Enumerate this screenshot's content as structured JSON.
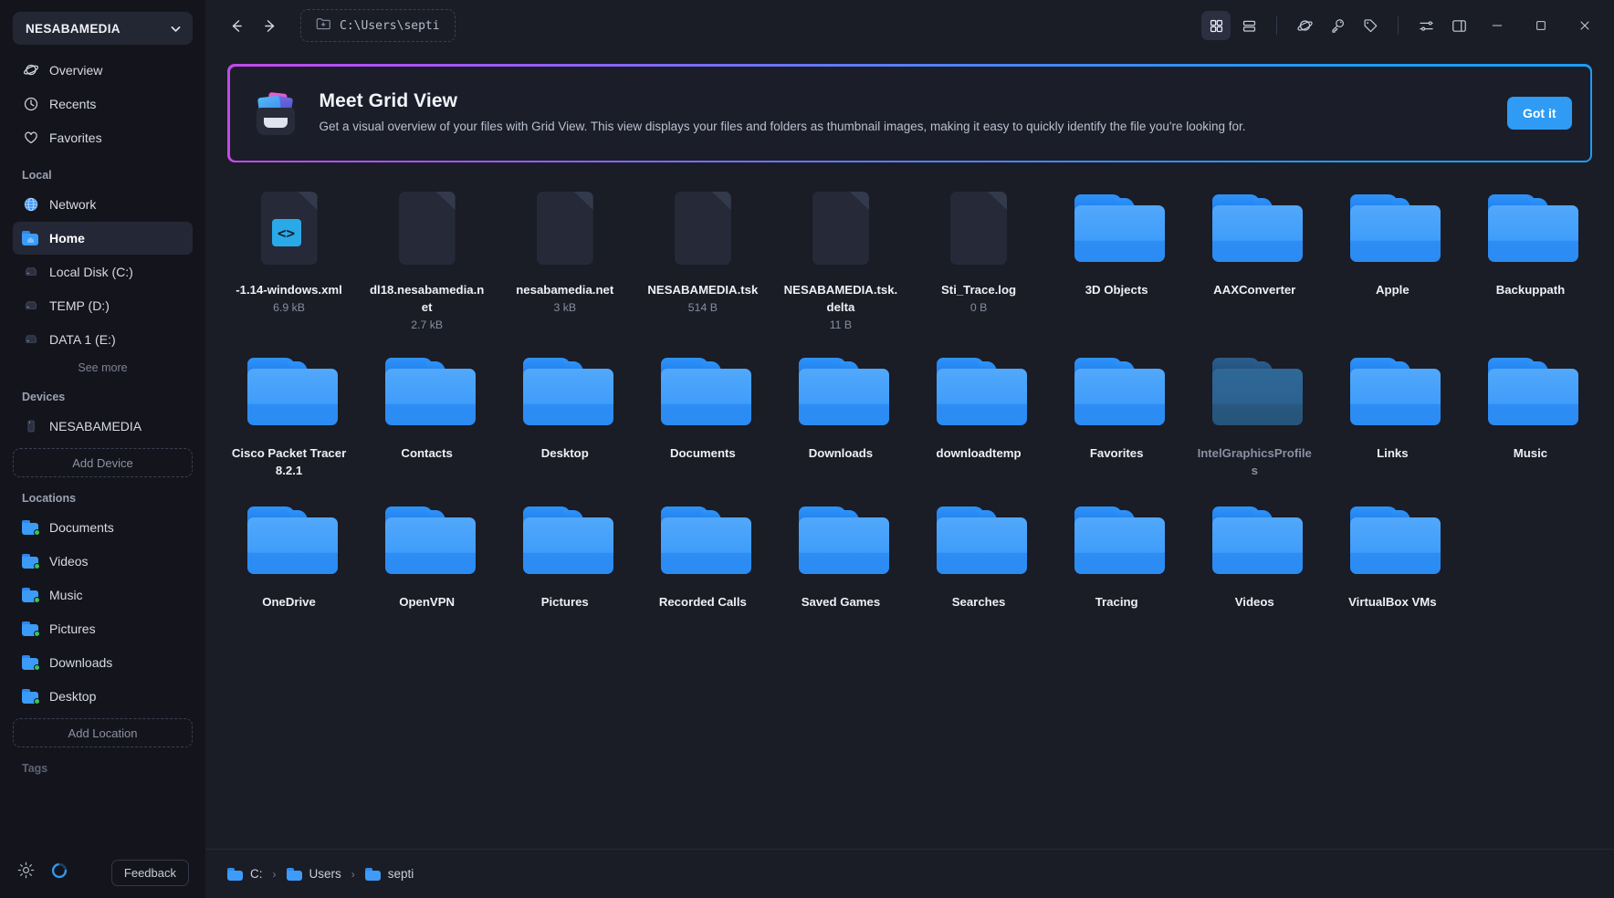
{
  "sidebar": {
    "drive_selector": {
      "label": "NESABAMEDIA",
      "icon": "chevron-down-icon"
    },
    "top_items": [
      {
        "label": "Overview",
        "icon": "planet-icon"
      },
      {
        "label": "Recents",
        "icon": "clock-icon"
      },
      {
        "label": "Favorites",
        "icon": "heart-icon"
      }
    ],
    "local": {
      "title": "Local",
      "items": [
        {
          "label": "Network",
          "icon": "globe-icon",
          "active": false
        },
        {
          "label": "Home",
          "icon": "home-folder-icon",
          "active": true
        },
        {
          "label": "Local Disk (C:)",
          "icon": "drive-icon",
          "active": false
        },
        {
          "label": "TEMP (D:)",
          "icon": "drive-icon",
          "active": false
        },
        {
          "label": "DATA 1 (E:)",
          "icon": "drive-icon",
          "active": false
        }
      ],
      "see_more": "See more"
    },
    "devices": {
      "title": "Devices",
      "items": [
        {
          "label": "NESABAMEDIA",
          "icon": "phone-icon"
        }
      ],
      "add_label": "Add Device"
    },
    "locations": {
      "title": "Locations",
      "items": [
        {
          "label": "Documents",
          "icon": "folder-sync-icon"
        },
        {
          "label": "Videos",
          "icon": "folder-sync-icon"
        },
        {
          "label": "Music",
          "icon": "folder-sync-icon"
        },
        {
          "label": "Pictures",
          "icon": "folder-sync-icon"
        },
        {
          "label": "Downloads",
          "icon": "folder-sync-icon"
        },
        {
          "label": "Desktop",
          "icon": "folder-sync-icon"
        }
      ],
      "add_label": "Add Location"
    },
    "tags": {
      "title": "Tags"
    },
    "footer": {
      "settings_icon": "gear-icon",
      "status_icon": "sync-circle-icon",
      "feedback_label": "Feedback"
    }
  },
  "titlebar": {
    "back_icon": "arrow-left-icon",
    "forward_icon": "arrow-right-icon",
    "path_value": "C:\\Users\\septi",
    "path_icon": "folder-plus-icon",
    "tools": [
      {
        "name": "grid-view-icon",
        "active": true
      },
      {
        "name": "list-view-icon",
        "active": false
      },
      {
        "name": "planet-icon",
        "active": false
      },
      {
        "name": "key-icon",
        "active": false
      },
      {
        "name": "tag-icon",
        "active": false
      },
      {
        "name": "sliders-icon",
        "active": false
      },
      {
        "name": "sidebar-panel-icon",
        "active": false
      }
    ],
    "window": {
      "minimize": "minimize-icon",
      "maximize": "maximize-icon",
      "close": "close-icon"
    }
  },
  "banner": {
    "title": "Meet Grid View",
    "description": "Get a visual overview of your files with Grid View. This view displays your files and folders as thumbnail images, making it easy to quickly identify the file you're looking for.",
    "button_label": "Got it",
    "accent_start": "#c44ae8",
    "accent_end": "#1e9bf5",
    "button_color": "#2f9bf5"
  },
  "files": [
    {
      "name": "-1.14-windows.xml",
      "size": "6.9 kB",
      "type": "file",
      "badge": "<>",
      "badge_color": "#2aa9e8"
    },
    {
      "name": "dl18.nesabamedia.net",
      "size": "2.7 kB",
      "type": "file",
      "badge": "",
      "badge_color": ""
    },
    {
      "name": "nesabamedia.net",
      "size": "3 kB",
      "type": "file",
      "badge": "",
      "badge_color": ""
    },
    {
      "name": "NESABAMEDIA.tsk",
      "size": "514 B",
      "type": "file",
      "badge": "",
      "badge_color": ""
    },
    {
      "name": "NESABAMEDIA.tsk.delta",
      "size": "11 B",
      "type": "file",
      "badge": "",
      "badge_color": ""
    },
    {
      "name": "Sti_Trace.log",
      "size": "0 B",
      "type": "file",
      "badge": "",
      "badge_color": ""
    },
    {
      "name": "3D Objects",
      "size": "",
      "type": "folder"
    },
    {
      "name": "AAXConverter",
      "size": "",
      "type": "folder"
    },
    {
      "name": "Apple",
      "size": "",
      "type": "folder"
    },
    {
      "name": "Backuppath",
      "size": "",
      "type": "folder"
    },
    {
      "name": "Cisco Packet Tracer 8.2.1",
      "size": "",
      "type": "folder"
    },
    {
      "name": "Contacts",
      "size": "",
      "type": "folder"
    },
    {
      "name": "Desktop",
      "size": "",
      "type": "folder"
    },
    {
      "name": "Documents",
      "size": "",
      "type": "folder"
    },
    {
      "name": "Downloads",
      "size": "",
      "type": "folder"
    },
    {
      "name": "downloadtemp",
      "size": "",
      "type": "folder"
    },
    {
      "name": "Favorites",
      "size": "",
      "type": "folder"
    },
    {
      "name": "IntelGraphicsProfiles",
      "size": "",
      "type": "folder",
      "hidden": true
    },
    {
      "name": "Links",
      "size": "",
      "type": "folder"
    },
    {
      "name": "Music",
      "size": "",
      "type": "folder"
    },
    {
      "name": "OneDrive",
      "size": "",
      "type": "folder"
    },
    {
      "name": "OpenVPN",
      "size": "",
      "type": "folder"
    },
    {
      "name": "Pictures",
      "size": "",
      "type": "folder"
    },
    {
      "name": "Recorded Calls",
      "size": "",
      "type": "folder"
    },
    {
      "name": "Saved Games",
      "size": "",
      "type": "folder"
    },
    {
      "name": "Searches",
      "size": "",
      "type": "folder"
    },
    {
      "name": "Tracing",
      "size": "",
      "type": "folder"
    },
    {
      "name": "Videos",
      "size": "",
      "type": "folder"
    },
    {
      "name": "VirtualBox VMs",
      "size": "",
      "type": "folder"
    }
  ],
  "breadcrumb": [
    {
      "label": "C:"
    },
    {
      "label": "Users"
    },
    {
      "label": "septi"
    }
  ],
  "breadcrumb_separator": "›"
}
